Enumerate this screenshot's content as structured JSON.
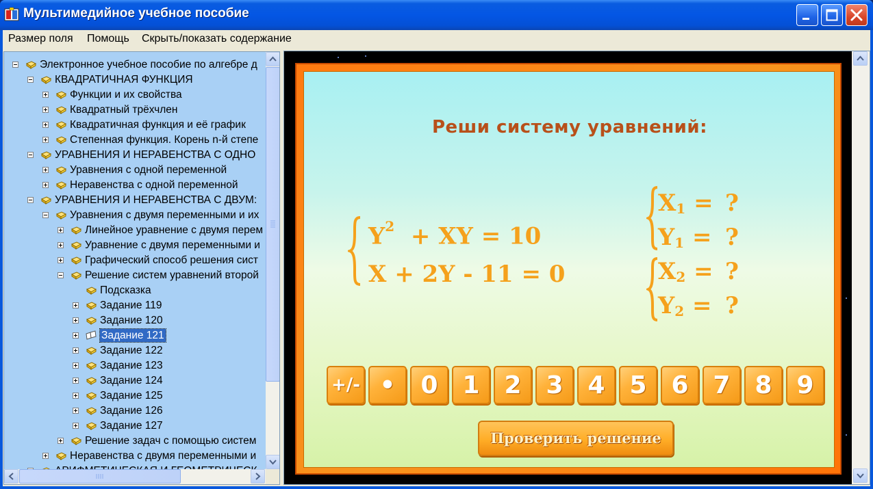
{
  "window": {
    "title": "Мультимедийное учебное пособие"
  },
  "menu": {
    "items": [
      "Размер поля",
      "Помощь",
      "Скрыть/показать содержание"
    ]
  },
  "tree": {
    "items": [
      {
        "label": "Электронное учебное пособие по алгебре д",
        "level": 0,
        "toggle": "minus"
      },
      {
        "label": "КВАДРАТИЧНАЯ ФУНКЦИЯ",
        "level": 1,
        "toggle": "minus"
      },
      {
        "label": "Функции и их свойства",
        "level": 2,
        "toggle": "plus"
      },
      {
        "label": "Квадратный трёхчлен",
        "level": 2,
        "toggle": "plus"
      },
      {
        "label": "Квадратичная функция и её график",
        "level": 2,
        "toggle": "plus"
      },
      {
        "label": "Степенная функция. Корень n-й степе",
        "level": 2,
        "toggle": "plus"
      },
      {
        "label": "УРАВНЕНИЯ И НЕРАВЕНСТВА С ОДНО",
        "level": 1,
        "toggle": "minus"
      },
      {
        "label": "Уравнения с одной переменной",
        "level": 2,
        "toggle": "plus"
      },
      {
        "label": "Неравенства с одной переменной",
        "level": 2,
        "toggle": "plus"
      },
      {
        "label": "УРАВНЕНИЯ И НЕРАВЕНСТВА С ДВУМ:",
        "level": 1,
        "toggle": "minus"
      },
      {
        "label": "Уравнения с двумя переменными и их",
        "level": 2,
        "toggle": "minus"
      },
      {
        "label": "Линейное уравнение с двумя перем",
        "level": 3,
        "toggle": "plus"
      },
      {
        "label": "Уравнение с двумя переменными и",
        "level": 3,
        "toggle": "plus"
      },
      {
        "label": "Графический способ решения сист",
        "level": 3,
        "toggle": "plus"
      },
      {
        "label": "Решение систем уравнений второй",
        "level": 3,
        "toggle": "minus"
      },
      {
        "label": "Подсказка",
        "level": 4,
        "toggle": "none"
      },
      {
        "label": "Задание 119",
        "level": 4,
        "toggle": "plus"
      },
      {
        "label": "Задание 120",
        "level": 4,
        "toggle": "plus"
      },
      {
        "label": "Задание 121",
        "level": 4,
        "toggle": "plus",
        "selected": true
      },
      {
        "label": "Задание 122",
        "level": 4,
        "toggle": "plus"
      },
      {
        "label": "Задание 123",
        "level": 4,
        "toggle": "plus"
      },
      {
        "label": "Задание 124",
        "level": 4,
        "toggle": "plus"
      },
      {
        "label": "Задание 125",
        "level": 4,
        "toggle": "plus"
      },
      {
        "label": "Задание 126",
        "level": 4,
        "toggle": "plus"
      },
      {
        "label": "Задание 127",
        "level": 4,
        "toggle": "plus"
      },
      {
        "label": "Решение задач с помощью систем",
        "level": 3,
        "toggle": "plus"
      },
      {
        "label": "Неравенства с двумя переменными и",
        "level": 2,
        "toggle": "plus"
      },
      {
        "label": "АРИФМЕТИЧЕСКАЯ И ГЕОМЕТРИЧЕСК",
        "level": 1,
        "toggle": "plus"
      }
    ]
  },
  "task": {
    "title": "Реши систему уравнений:",
    "equation1": {
      "left": "Y",
      "power": "2",
      "right": "+ XY = 10"
    },
    "equation2": {
      "left": "X + 2Y",
      "minus": "-",
      "right": "11 = 0"
    },
    "answers": [
      {
        "var": "X",
        "sub": "1",
        "rest": " = ",
        "value": "?"
      },
      {
        "var": "Y",
        "sub": "1",
        "rest": " = ",
        "value": "?"
      },
      {
        "var": "X",
        "sub": "2",
        "rest": " = ",
        "value": "?"
      },
      {
        "var": "Y",
        "sub": "2",
        "rest": " = ",
        "value": "?"
      }
    ],
    "keys": [
      "+/-",
      "•",
      "0",
      "1",
      "2",
      "3",
      "4",
      "5",
      "6",
      "7",
      "8",
      "9"
    ],
    "check_button": "Проверить решение"
  },
  "colors": {
    "frame_orange": "#f7941d",
    "equation_color": "#f5a11c",
    "title_color": "#b8501a",
    "tree_background": "#a9d0f5",
    "selected_item": "#316ac5"
  }
}
